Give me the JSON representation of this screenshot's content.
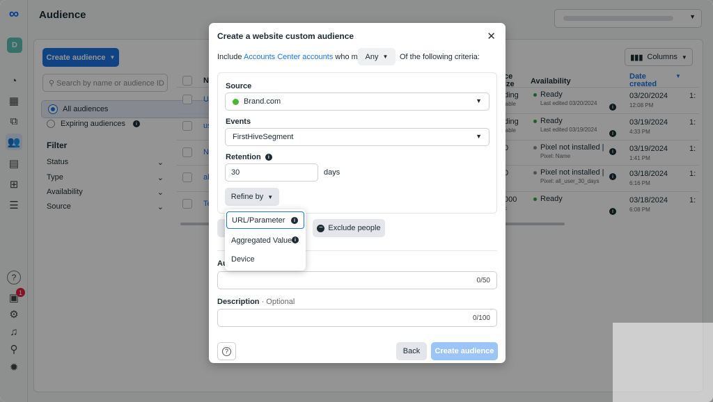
{
  "header": {
    "title": "Audience"
  },
  "toolbar": {
    "create_label": "Create audience",
    "columns_label": "Columns"
  },
  "sidebar": {
    "account_initial": "D",
    "notification_count": "1",
    "help_label": "?"
  },
  "search": {
    "placeholder": "Search by name or audience ID"
  },
  "audience_filter": {
    "all": "All audiences",
    "expiring": "Expiring audiences"
  },
  "filter": {
    "title": "Filter",
    "items": [
      "Status",
      "Type",
      "Availability",
      "Source"
    ]
  },
  "table": {
    "headers": {
      "name": "N",
      "size_top": "ce",
      "size_bottom": "ize",
      "availability": "Availability",
      "date_top": "Date",
      "date_bottom": "created"
    },
    "rows": [
      {
        "name": "U",
        "size": "ding",
        "size_sub": "lable",
        "avail": "Ready",
        "avail_sub": "Last edited 03/20/2024",
        "date": "03/20/2024",
        "time": "12:08 PM",
        "extra": "1:"
      },
      {
        "name": "us",
        "size": "ding",
        "size_sub": "lable",
        "avail": "Ready",
        "avail_sub": "Last edited 03/19/2024",
        "date": "03/19/2024",
        "time": "4:33 PM",
        "extra": "1:"
      },
      {
        "name": "N",
        "size": "0",
        "size_sub": "",
        "avail": "Pixel not installed |",
        "avail_sub": "Pixel: Name",
        "date": "03/19/2024",
        "time": "1:41 PM",
        "extra": "1:"
      },
      {
        "name": "al",
        "size": "0",
        "size_sub": "",
        "avail": "Pixel not installed |",
        "avail_sub": "Pixel: all_user_30_days",
        "date": "03/18/2024",
        "time": "6:16 PM",
        "extra": "1:"
      },
      {
        "name": "Te",
        "size": "000",
        "size_sub": "c",
        "avail": "Ready",
        "avail_sub": "",
        "date": "03/18/2024",
        "time": "6:08 PM",
        "extra": "1:"
      }
    ]
  },
  "modal": {
    "title": "Create a website custom audience",
    "criteria_prefix": "Include",
    "criteria_link": "Accounts Center accounts",
    "criteria_mid": "who meet",
    "any_label": "Any",
    "criteria_suffix": "Of the following criteria:",
    "source_label": "Source",
    "source_value": "Brand.com",
    "events_label": "Events",
    "events_value": "FirstHiveSegment",
    "retention_label": "Retention",
    "retention_value": "30",
    "retention_unit": "days",
    "refine_label": "Refine by",
    "exclude_label": "Exclude people",
    "name_label": "Au",
    "name_counter": "0/50",
    "description_label": "Description",
    "description_optional": "· Optional",
    "description_counter": "0/100",
    "back_label": "Back",
    "submit_label": "Create audience"
  },
  "refine_menu": {
    "items": [
      "URL/Parameter",
      "Aggregated Value",
      "Device"
    ]
  },
  "colors": {
    "accent": "#1b74e4",
    "source_status": "#4cb832",
    "ready": "#31a24c"
  }
}
